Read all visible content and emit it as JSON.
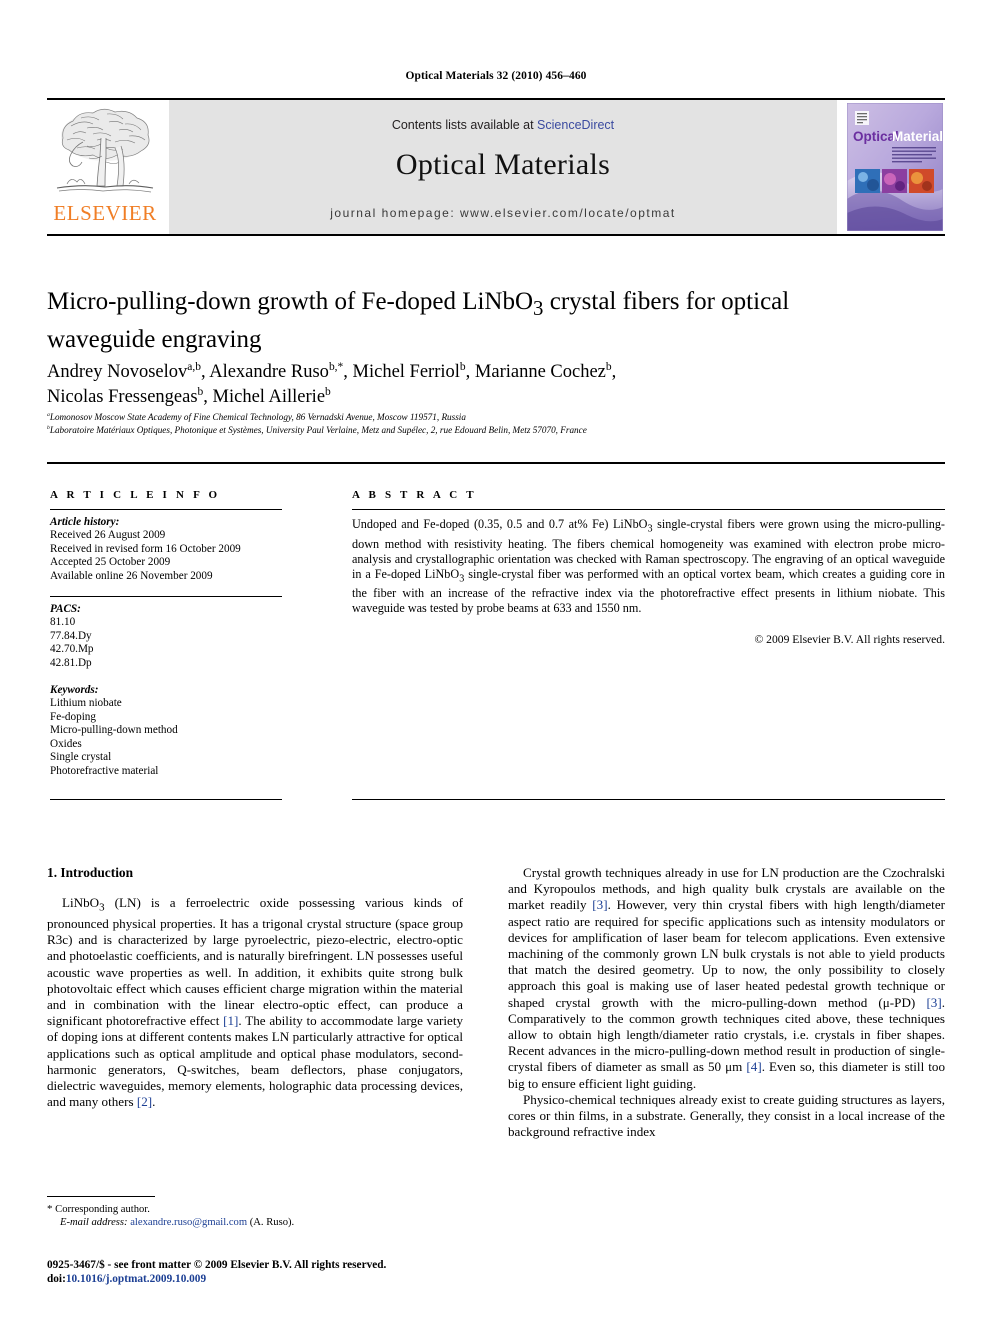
{
  "running_head": "Optical Materials 32 (2010) 456–460",
  "masthead": {
    "publisher_name": "ELSEVIER",
    "contents_prefix": "Contents lists available at ",
    "sciencedirect": "ScienceDirect",
    "journal_title": "Optical Materials",
    "homepage": "journal homepage: www.elsevier.com/locate/optmat",
    "cover_title_1": "Optical",
    "cover_title_2": "Materials",
    "accent_orange": "#F07E26",
    "link_blue": "#3b4ba0",
    "banner_gray": "#e3e3e3"
  },
  "article": {
    "title_part1": "Micro-pulling-down growth of Fe-doped LiNbO",
    "title_sub": "3",
    "title_part2": " crystal fibers for optical waveguide engraving",
    "authors": [
      {
        "name": "Andrey Novoselov",
        "marks": "a,b",
        "sep": ", "
      },
      {
        "name": "Alexandre Ruso",
        "marks": "b,*",
        "sep": ", "
      },
      {
        "name": "Michel Ferriol",
        "marks": "b",
        "sep": ", "
      },
      {
        "name": "Marianne Cochez",
        "marks": "b",
        "sep": ", "
      },
      {
        "name": "Nicolas Fressengeas",
        "marks": "b",
        "sep": ", "
      },
      {
        "name": "Michel Aillerie",
        "marks": "b",
        "sep": ""
      }
    ],
    "affiliations": [
      {
        "mark": "a",
        "text": "Lomonosov Moscow State Academy of Fine Chemical Technology, 86 Vernadski Avenue, Moscow 119571, Russia"
      },
      {
        "mark": "b",
        "text": "Laboratoire Matériaux Optiques, Photonique et Systèmes, University Paul Verlaine, Metz and Supélec, 2, rue Edouard Belin, Metz 57070, France"
      }
    ]
  },
  "headings": {
    "article_info": "A R T I C L E  I N F O",
    "abstract": "A B S T R A C T"
  },
  "article_info": {
    "history_label": "Article history:",
    "history": [
      "Received 26 August 2009",
      "Received in revised form 16 October 2009",
      "Accepted 25 October 2009",
      "Available online 26 November 2009"
    ],
    "pacs_label": "PACS:",
    "pacs": [
      "81.10",
      "77.84.Dy",
      "42.70.Mp",
      "42.81.Dp"
    ],
    "keywords_label": "Keywords:",
    "keywords": [
      "Lithium niobate",
      "Fe-doping",
      "Micro-pulling-down method",
      "Oxides",
      "Single crystal",
      "Photorefractive material"
    ]
  },
  "abstract": {
    "text": "Undoped and Fe-doped (0.35, 0.5 and 0.7 at% Fe) LiNbO3 single-crystal fibers were grown using the micro-pulling-down method with resistivity heating. The fibers chemical homogeneity was examined with electron probe micro-analysis and crystallographic orientation was checked with Raman spectroscopy. The engraving of an optical waveguide in a Fe-doped LiNbO3 single-crystal fiber was performed with an optical vortex beam, which creates a guiding core in the fiber with an increase of the refractive index via the photorefractive effect presents in lithium niobate. This waveguide was tested by probe beams at 633 and 1550 nm.",
    "copyright": "© 2009 Elsevier B.V. All rights reserved."
  },
  "body": {
    "section_heading": "1. Introduction",
    "left_para_1": "LiNbO3 (LN) is a ferroelectric oxide possessing various kinds of pronounced physical properties. It has a trigonal crystal structure (space group R3c) and is characterized by large pyroelectric, piezo-electric, electro-optic and photoelastic coefficients, and is naturally birefringent. LN possesses useful acoustic wave properties as well. In addition, it exhibits quite strong bulk photovoltaic effect which causes efficient charge migration within the material and in combination with the linear electro-optic effect, can produce a significant photorefractive effect [1]. The ability to accommodate large variety of doping ions at different contents makes LN particularly attractive for optical applications such as optical amplitude and optical phase modulators, second-harmonic generators, Q-switches, beam deflectors, phase conjugators, dielectric waveguides, memory elements, holographic data processing devices, and many others [2].",
    "right_para_1": "Crystal growth techniques already in use for LN production are the Czochralski and Kyropoulos methods, and high quality bulk crystals are available on the market readily [3]. However, very thin crystal fibers with high length/diameter aspect ratio are required for specific applications such as intensity modulators or devices for amplification of laser beam for telecom applications. Even extensive machining of the commonly grown LN bulk crystals is not able to yield products that match the desired geometry. Up to now, the only possibility to closely approach this goal is making use of laser heated pedestal growth technique or shaped crystal growth with the micro-pulling-down method (μ-PD) [3]. Comparatively to the common growth techniques cited above, these techniques allow to obtain high length/diameter ratio crystals, i.e. crystals in fiber shapes. Recent advances in the micro-pulling-down method result in production of single-crystal fibers of diameter as small as 50 μm [4]. Even so, this diameter is still too big to ensure efficient light guiding.",
    "right_para_2": "Physico-chemical techniques already exist to create guiding structures as layers, cores or thin films, in a substrate. Generally, they consist in a local increase of the background refractive index"
  },
  "footnote": {
    "star": "*",
    "corresponding": "Corresponding author.",
    "email_label": "E-mail address:",
    "email": "alexandre.ruso@gmail.com",
    "email_suffix": "(A. Ruso)."
  },
  "issn": {
    "line1": "0925-3467/$ - see front matter © 2009 Elsevier B.V. All rights reserved.",
    "doi_prefix": "doi:",
    "doi": "10.1016/j.optmat.2009.10.009"
  }
}
